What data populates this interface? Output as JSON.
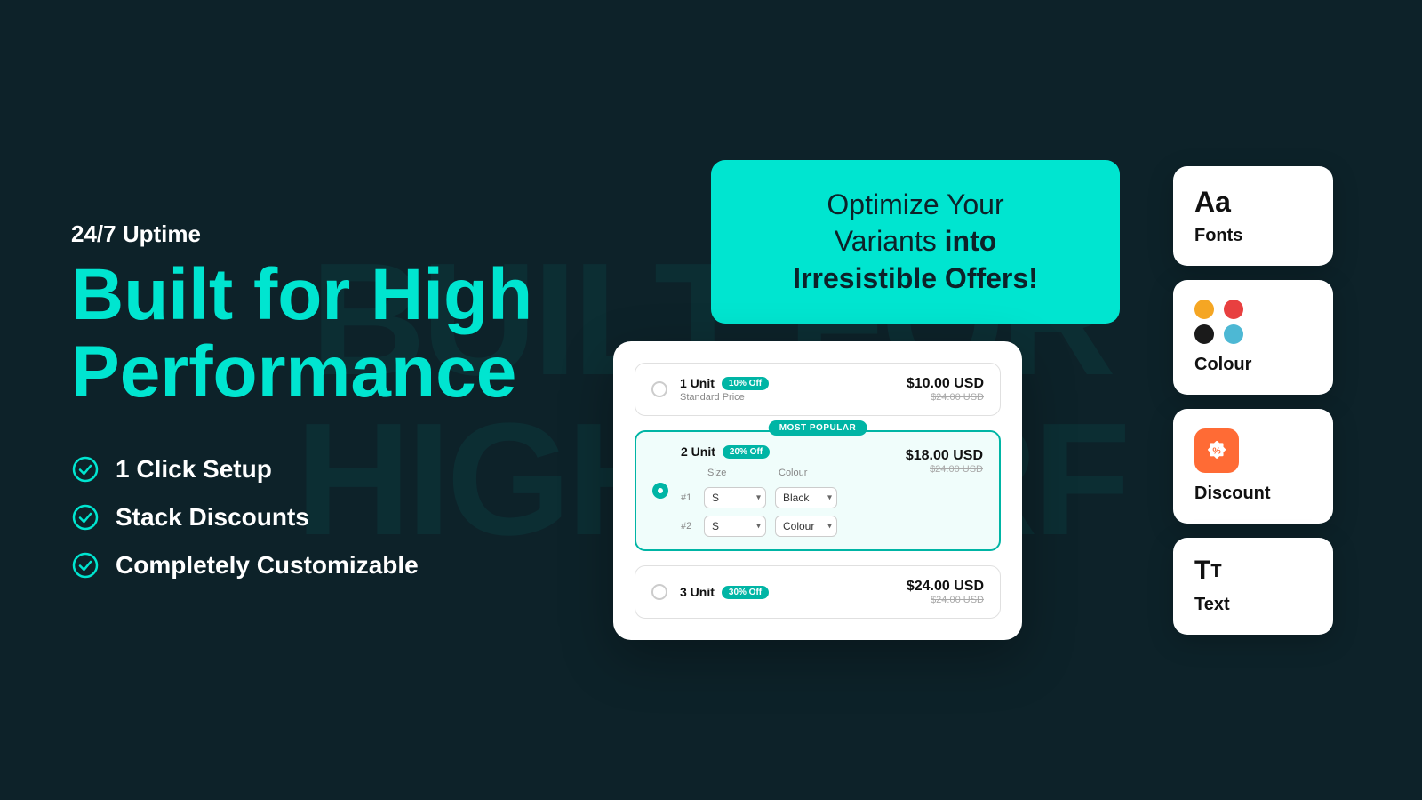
{
  "background": {
    "watermark_line1": "BUILT FOR",
    "watermark_line2": "HIGH PERF"
  },
  "left": {
    "uptime_label": "24/7 Uptime",
    "heading_line1": "Built for High",
    "heading_line2": "Performance",
    "features": [
      {
        "id": "feature-1-click",
        "text": "1 Click Setup"
      },
      {
        "id": "feature-stack",
        "text": "Stack Discounts"
      },
      {
        "id": "feature-custom",
        "text": "Completely Customizable"
      }
    ]
  },
  "middle": {
    "optimize_card": {
      "line1": "Optimize Your",
      "line2_normal": "Variants ",
      "line2_bold": "into",
      "line3": "Irresistible Offers!"
    },
    "product_widget": {
      "options": [
        {
          "id": "opt-1",
          "title": "1 Unit",
          "badge": "10% Off",
          "sublabel": "Standard Price",
          "price": "$10.00 USD",
          "original_price": "$24.00 USD",
          "selected": false,
          "most_popular": false
        },
        {
          "id": "opt-2",
          "title": "2 Unit",
          "badge": "20% Off",
          "sublabel": "",
          "price": "$18.00 USD",
          "original_price": "$24.00 USD",
          "selected": true,
          "most_popular": true,
          "most_popular_label": "MOST POPULAR",
          "variants": [
            {
              "num": "#1",
              "size": "S",
              "colour": "Black"
            },
            {
              "num": "#2",
              "size": "S",
              "colour": "Colour"
            }
          ],
          "variant_headers": [
            "Size",
            "Colour"
          ]
        },
        {
          "id": "opt-3",
          "title": "3 Unit",
          "badge": "30% Off",
          "sublabel": "",
          "price": "$24.00 USD",
          "original_price": "$24.00 USD",
          "selected": false,
          "most_popular": false
        }
      ]
    }
  },
  "right": {
    "cards": [
      {
        "id": "fonts-card",
        "icon_text": "Aa",
        "label": "Fonts"
      },
      {
        "id": "colour-card",
        "label": "Colour",
        "dots": [
          {
            "color": "#f5a623"
          },
          {
            "color": "#e84040"
          },
          {
            "color": "#1a1a1a"
          },
          {
            "color": "#4db8d4"
          }
        ]
      },
      {
        "id": "discount-card",
        "label": "Discount"
      },
      {
        "id": "text-card",
        "label": "Text"
      }
    ]
  }
}
